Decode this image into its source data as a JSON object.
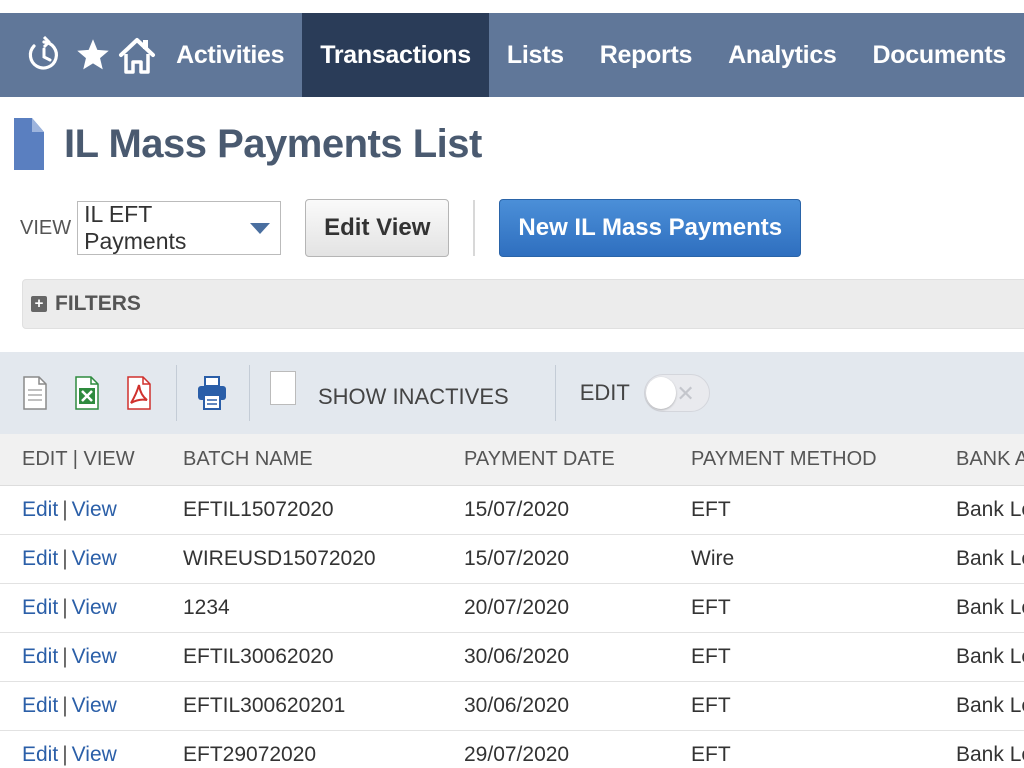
{
  "nav": {
    "icons": [
      "recent-icon",
      "star-icon",
      "home-icon"
    ],
    "items": [
      {
        "label": "Activities",
        "active": false
      },
      {
        "label": "Transactions",
        "active": true
      },
      {
        "label": "Lists",
        "active": false
      },
      {
        "label": "Reports",
        "active": false
      },
      {
        "label": "Analytics",
        "active": false
      },
      {
        "label": "Documents",
        "active": false
      }
    ]
  },
  "page": {
    "title": "IL Mass Payments List"
  },
  "view": {
    "label": "VIEW",
    "selected": "IL EFT Payments",
    "edit_view_label": "Edit View",
    "new_label": "New IL Mass Payments"
  },
  "filters": {
    "label": "FILTERS"
  },
  "toolbar": {
    "show_inactives_label": "SHOW INACTIVES",
    "edit_label": "EDIT"
  },
  "table": {
    "columns": [
      "EDIT | VIEW",
      "BATCH NAME",
      "PAYMENT DATE",
      "PAYMENT METHOD",
      "BANK AC"
    ],
    "edit_link": "Edit",
    "separator": "|",
    "view_link": "View",
    "rows": [
      {
        "batch": "EFTIL15072020",
        "date": "15/07/2020",
        "method": "EFT",
        "bank": "Bank Leu"
      },
      {
        "batch": "WIREUSD15072020",
        "date": "15/07/2020",
        "method": "Wire",
        "bank": "Bank Leu"
      },
      {
        "batch": "1234",
        "date": "20/07/2020",
        "method": "EFT",
        "bank": "Bank Leu"
      },
      {
        "batch": "EFTIL30062020",
        "date": "30/06/2020",
        "method": "EFT",
        "bank": "Bank Leu"
      },
      {
        "batch": "EFTIL300620201",
        "date": "30/06/2020",
        "method": "EFT",
        "bank": "Bank Leu"
      },
      {
        "batch": "EFT29072020",
        "date": "29/07/2020",
        "method": "EFT",
        "bank": "Bank Leu"
      }
    ]
  },
  "colors": {
    "nav_bg": "#607799",
    "nav_active_bg": "#2a3c58",
    "primary_button": "#2f6fbf",
    "link": "#2b5fa8"
  }
}
